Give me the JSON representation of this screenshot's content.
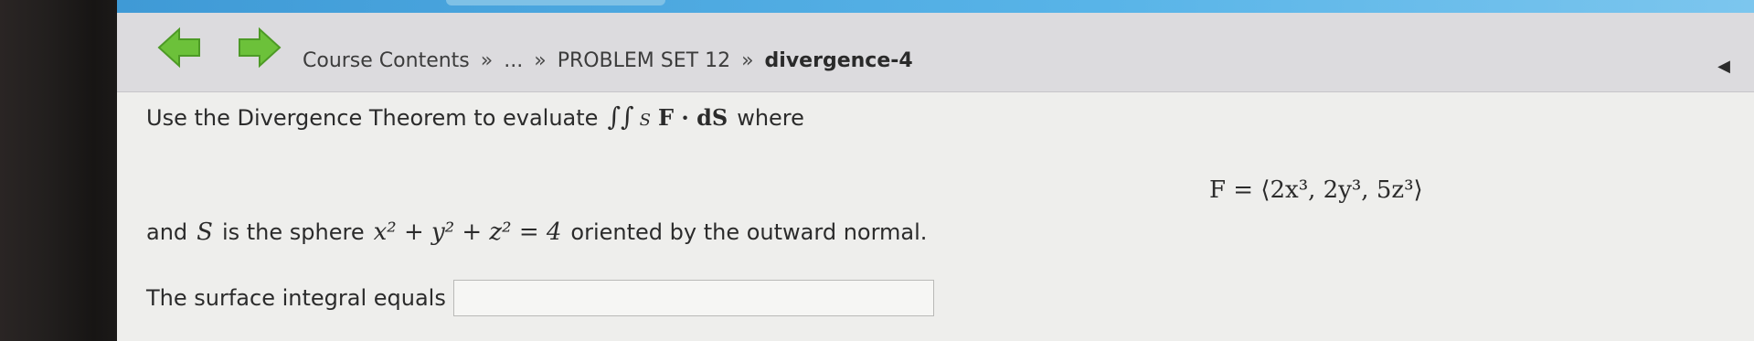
{
  "nav": {
    "breadcrumb": [
      "Course Contents",
      "...",
      "PROBLEM SET 12"
    ],
    "current": "divergence-4",
    "separator": "»"
  },
  "problem": {
    "intro": "Use the Divergence Theorem to evaluate",
    "integral": "∫∫",
    "subscript": "S",
    "integrand": "F · dS",
    "where": "where",
    "field_equation": "F = ⟨2x³, 2y³, 5z³⟩",
    "surface_prefix": "and",
    "surface_var": "S",
    "surface_text": "is the sphere",
    "sphere_equation": "x² + y² + z² = 4",
    "orientation": "oriented by the outward normal.",
    "answer_label": "The surface integral equals",
    "answer_value": ""
  },
  "colors": {
    "nav_arrow": "#6cc13a",
    "top_bar": "#58b4e8",
    "nav_bg": "#dcdbde",
    "content_bg": "#eeeeec"
  },
  "icons": {
    "prev": "left-arrow-icon",
    "next": "right-arrow-icon",
    "side": "triangle-left-icon"
  }
}
